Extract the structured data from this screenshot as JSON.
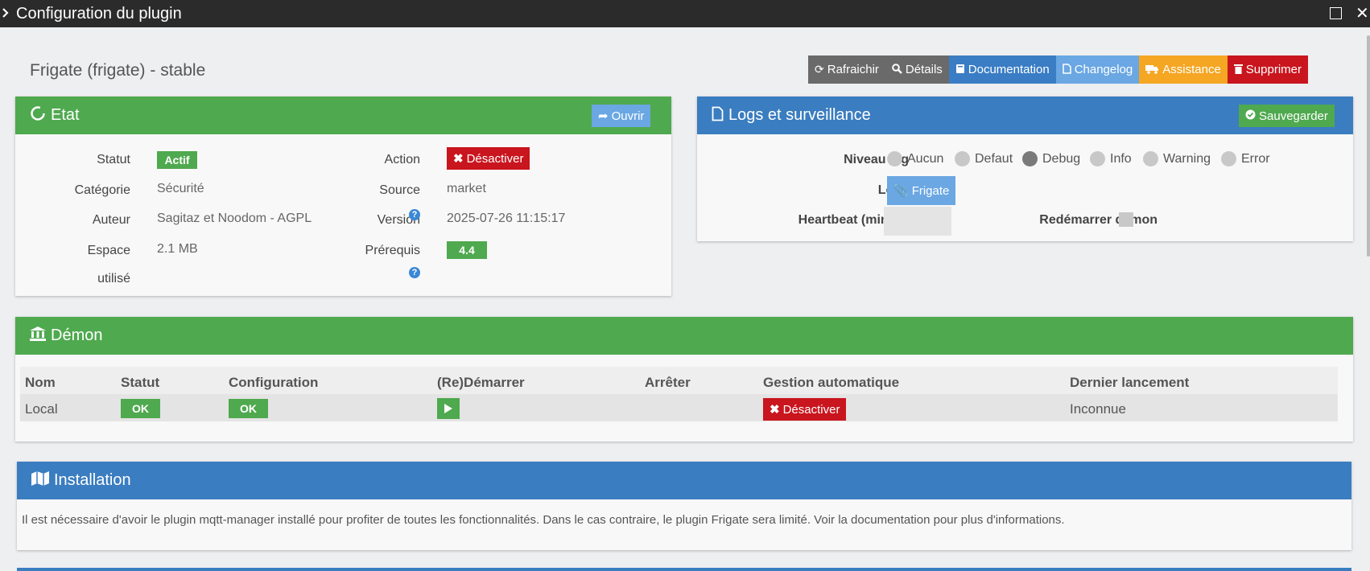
{
  "window": {
    "title": "Configuration du plugin"
  },
  "plugin": {
    "heading": "Frigate (frigate) - stable"
  },
  "toolbar": {
    "refresh": "Rafraichir",
    "details": "Détails",
    "documentation": "Documentation",
    "changelog": "Changelog",
    "assistance": "Assistance",
    "delete": "Supprimer"
  },
  "etat": {
    "title": "Etat",
    "open_button": "Ouvrir",
    "statut_label": "Statut",
    "statut_value": "Actif",
    "categorie_label": "Catégorie",
    "categorie_value": "Sécurité",
    "auteur_label": "Auteur",
    "auteur_value": "Sagitaz et Noodom - AGPL",
    "espace_label_1": "Espace",
    "espace_label_2": "utilisé",
    "espace_value": "2.1 MB",
    "action_label": "Action",
    "action_button": "Désactiver",
    "source_label": "Source",
    "source_value": "market",
    "version_label": "Version",
    "version_value": "2025-07-26 11:15:17",
    "prerequis_label": "Prérequis",
    "prerequis_value": "4.4"
  },
  "logs": {
    "title": "Logs et surveillance",
    "save_button": "Sauvegarder",
    "niveau_label": "Niveau log",
    "levels": [
      "Aucun",
      "Defaut",
      "Debug",
      "Info",
      "Warning",
      "Error"
    ],
    "selected_level": "Debug",
    "logs_label": "Logs",
    "logs_button": "Frigate",
    "heartbeat_label": "Heartbeat (min)",
    "heartbeat_value": "",
    "restart_label": "Redémarrer démon",
    "restart_checked": false
  },
  "demon": {
    "title": "Démon",
    "headers": [
      "Nom",
      "Statut",
      "Configuration",
      "(Re)Démarrer",
      "Arrêter",
      "Gestion automatique",
      "Dernier lancement"
    ],
    "row": {
      "nom": "Local",
      "statut": "OK",
      "configuration": "OK",
      "gestion_button": "Désactiver",
      "dernier": "Inconnue"
    }
  },
  "installation": {
    "title": "Installation",
    "text": "Il est nécessaire d'avoir le plugin mqtt-manager installé pour profiter de toutes les fonctionnalités. Dans le cas contraire, le plugin Frigate sera limité. Voir la documentation pour plus d'informations."
  },
  "colors": {
    "green": "#4fa94f",
    "blue": "#3a7dc0",
    "red": "#c9151e",
    "orange": "#f5a623",
    "grey": "#6a6a6a",
    "lightblue": "#6aa7e3"
  },
  "icons": {
    "refresh": "refresh-icon",
    "details": "search-icon",
    "documentation": "book-icon",
    "changelog": "file-icon",
    "assistance": "truck-icon",
    "delete": "trash-icon"
  }
}
